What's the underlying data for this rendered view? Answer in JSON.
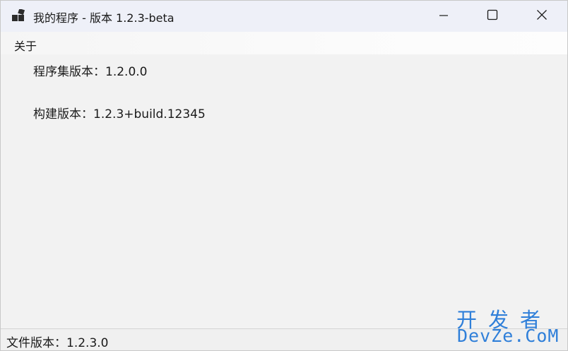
{
  "window": {
    "title": "我的程序 - 版本 1.2.3-beta",
    "app_icon": "app-window-icon",
    "controls": {
      "minimize_icon": "minimize-icon",
      "maximize_icon": "maximize-icon",
      "close_icon": "close-icon"
    }
  },
  "menubar": {
    "items": [
      {
        "label": "关于"
      }
    ]
  },
  "content": {
    "assembly_version": "程序集版本：1.2.0.0",
    "build_version": "构建版本：1.2.3+build.12345"
  },
  "statusbar": {
    "file_version": "文件版本：1.2.3.0"
  },
  "watermark": {
    "line1": "开发者",
    "line2": "DevZe.CoM"
  },
  "colors": {
    "titlebar_bg": "#eef0f8",
    "window_bg": "#f2f2f2",
    "watermark": "#2f7fd9"
  }
}
